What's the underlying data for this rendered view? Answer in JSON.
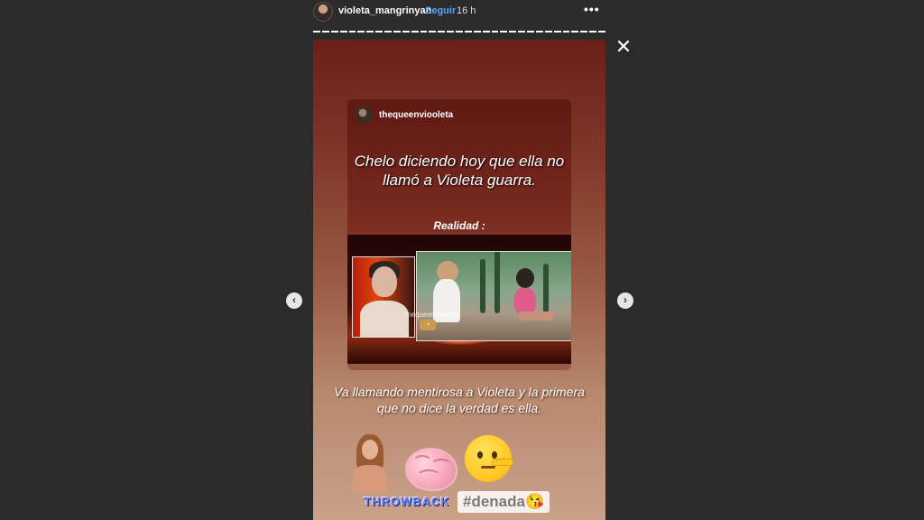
{
  "header": {
    "username": "violeta_mangrinyan",
    "separator": "•",
    "follow_label": "Seguir",
    "time": "16 h",
    "more_icon": "more-horizontal-icon"
  },
  "progress": {
    "total_segments": 33,
    "viewed_segments": 33
  },
  "controls": {
    "close_glyph": "✕",
    "prev_glyph": "‹",
    "next_glyph": "›"
  },
  "story": {
    "shared_post": {
      "username": "thequeenviooleta",
      "caption": "Chelo diciendo hoy que ella no llamó a Violeta guarra.",
      "subheading": "Realidad :",
      "video_watermark": "thequeenviooleta"
    },
    "caption": "Va llamando mentirosa a Violeta y la primera que no dice la verdad es ella.",
    "stickers": [
      "girl-sticker",
      "brain-emoji",
      "lying-face-emoji"
    ],
    "tags": {
      "throwback": "THROWBACK",
      "hashtag": "#denada😘"
    }
  },
  "colors": {
    "background": "#2b2b2b",
    "follow": "#58a6ff",
    "story_top": "#6a1f18",
    "story_bottom": "#c9a288"
  }
}
